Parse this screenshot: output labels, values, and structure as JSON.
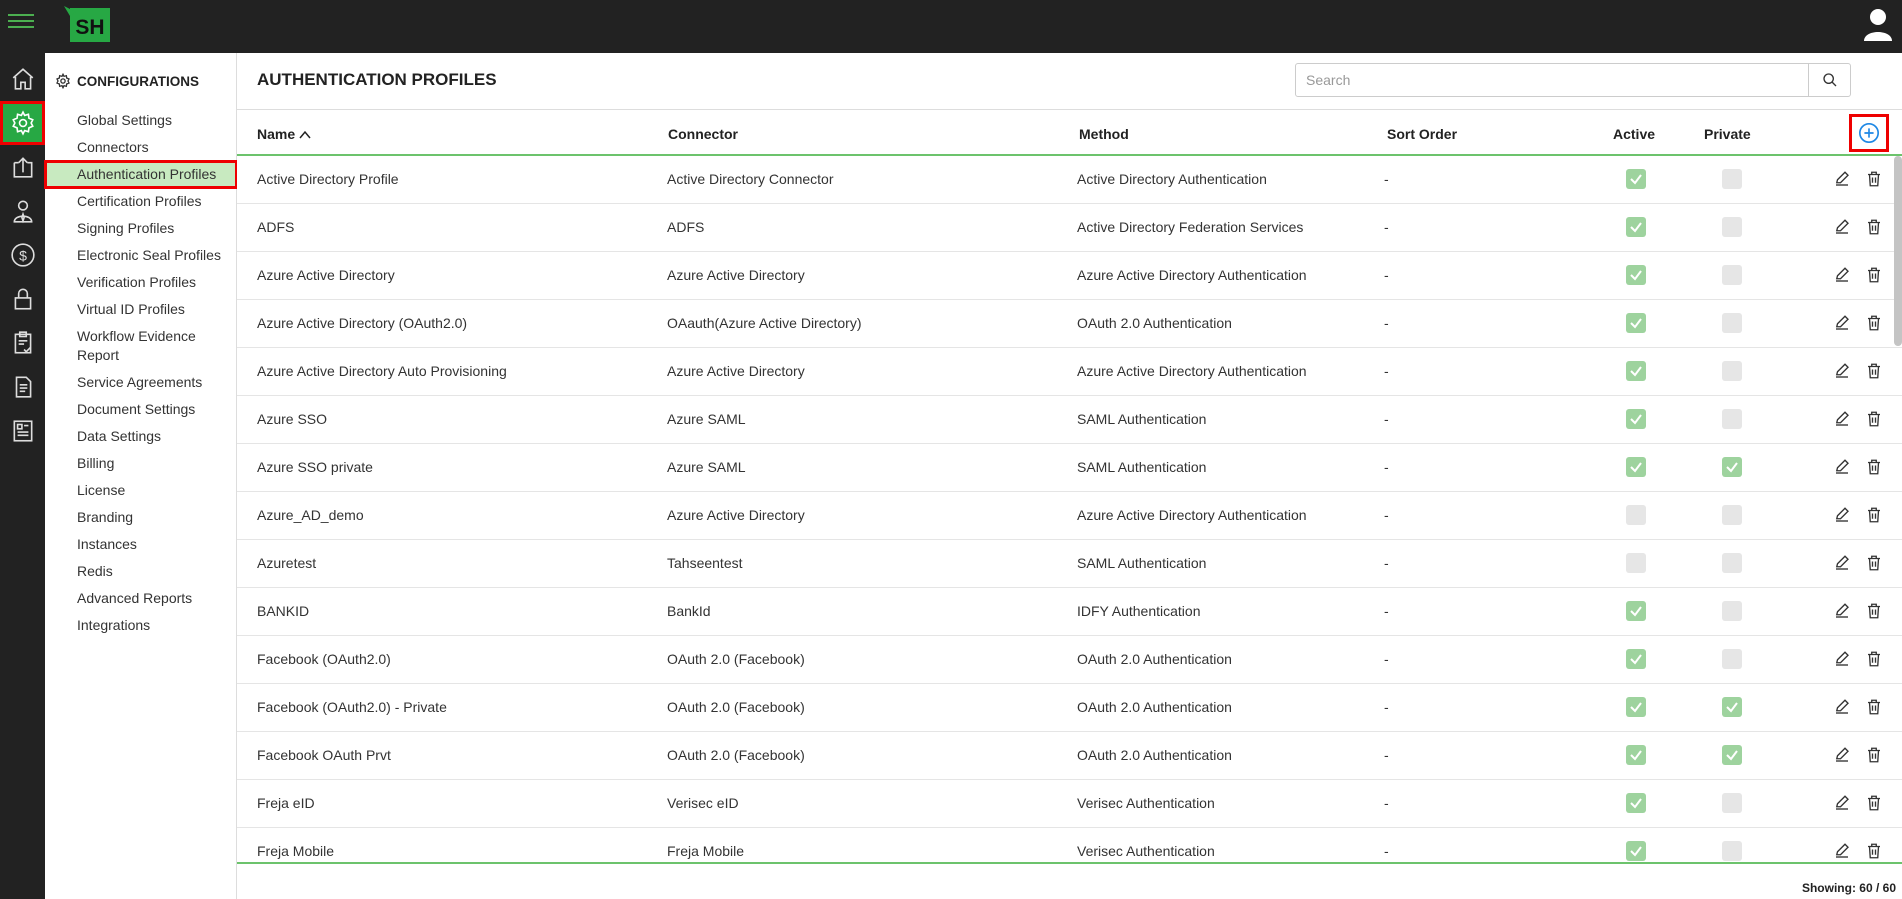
{
  "app": {
    "logo_text": "SH"
  },
  "rail": {
    "items": [
      "home-icon",
      "gear-icon",
      "upload-icon",
      "user-tie-icon",
      "dollar-icon",
      "lock-icon",
      "clipboard-check-icon",
      "document-icon",
      "report-icon"
    ],
    "active": "gear-icon"
  },
  "submenu": {
    "title": "CONFIGURATIONS",
    "items": [
      {
        "label": "Global Settings",
        "active": false
      },
      {
        "label": "Connectors",
        "active": false
      },
      {
        "label": "Authentication Profiles",
        "active": true
      },
      {
        "label": "Certification Profiles",
        "active": false
      },
      {
        "label": "Signing Profiles",
        "active": false
      },
      {
        "label": "Electronic Seal Profiles",
        "active": false
      },
      {
        "label": "Verification Profiles",
        "active": false
      },
      {
        "label": "Virtual ID Profiles",
        "active": false
      },
      {
        "label": "Workflow Evidence Report",
        "active": false
      },
      {
        "label": "Service Agreements",
        "active": false
      },
      {
        "label": "Document Settings",
        "active": false
      },
      {
        "label": "Data Settings",
        "active": false
      },
      {
        "label": "Billing",
        "active": false
      },
      {
        "label": "License",
        "active": false
      },
      {
        "label": "Branding",
        "active": false
      },
      {
        "label": "Instances",
        "active": false
      },
      {
        "label": "Redis",
        "active": false
      },
      {
        "label": "Advanced Reports",
        "active": false
      },
      {
        "label": "Integrations",
        "active": false
      }
    ]
  },
  "main": {
    "title": "AUTHENTICATION PROFILES",
    "search_placeholder": "Search",
    "columns": {
      "name": "Name",
      "connector": "Connector",
      "method": "Method",
      "sort_order": "Sort Order",
      "active": "Active",
      "private": "Private"
    },
    "rows": [
      {
        "name": "Active Directory Profile",
        "connector": "Active Directory Connector",
        "method": "Active Directory Authentication",
        "sort": "-",
        "active": true,
        "private": false
      },
      {
        "name": "ADFS",
        "connector": "ADFS",
        "method": "Active Directory Federation Services",
        "sort": "-",
        "active": true,
        "private": false
      },
      {
        "name": "Azure Active Directory",
        "connector": "Azure Active Directory",
        "method": "Azure Active Directory Authentication",
        "sort": "-",
        "active": true,
        "private": false
      },
      {
        "name": "Azure Active Directory (OAuth2.0)",
        "connector": "OAauth(Azure Active Directory)",
        "method": "OAuth 2.0 Authentication",
        "sort": "-",
        "active": true,
        "private": false
      },
      {
        "name": "Azure Active Directory Auto Provisioning",
        "connector": "Azure Active Directory",
        "method": "Azure Active Directory Authentication",
        "sort": "-",
        "active": true,
        "private": false
      },
      {
        "name": "Azure SSO",
        "connector": "Azure SAML",
        "method": "SAML Authentication",
        "sort": "-",
        "active": true,
        "private": false
      },
      {
        "name": "Azure SSO private",
        "connector": "Azure SAML",
        "method": "SAML Authentication",
        "sort": "-",
        "active": true,
        "private": true
      },
      {
        "name": "Azure_AD_demo",
        "connector": "Azure Active Directory",
        "method": "Azure Active Directory Authentication",
        "sort": "-",
        "active": false,
        "private": false
      },
      {
        "name": "Azuretest",
        "connector": "Tahseentest",
        "method": "SAML Authentication",
        "sort": "-",
        "active": false,
        "private": false
      },
      {
        "name": "BANKID",
        "connector": "BankId",
        "method": "IDFY Authentication",
        "sort": "-",
        "active": true,
        "private": false
      },
      {
        "name": "Facebook (OAuth2.0)",
        "connector": "OAuth 2.0 (Facebook)",
        "method": "OAuth 2.0 Authentication",
        "sort": "-",
        "active": true,
        "private": false
      },
      {
        "name": "Facebook (OAuth2.0) - Private",
        "connector": "OAuth 2.0 (Facebook)",
        "method": "OAuth 2.0 Authentication",
        "sort": "-",
        "active": true,
        "private": true
      },
      {
        "name": "Facebook OAuth Prvt",
        "connector": "OAuth 2.0 (Facebook)",
        "method": "OAuth 2.0 Authentication",
        "sort": "-",
        "active": true,
        "private": true
      },
      {
        "name": "Freja eID",
        "connector": "Verisec eID",
        "method": "Verisec Authentication",
        "sort": "-",
        "active": true,
        "private": false
      },
      {
        "name": "Freja Mobile",
        "connector": "Freja Mobile",
        "method": "Verisec Authentication",
        "sort": "-",
        "active": true,
        "private": false
      }
    ],
    "footer": "Showing: 60 / 60"
  },
  "colors": {
    "accent": "#27a844",
    "highlight": "#e00000",
    "topbar": "#222222"
  }
}
